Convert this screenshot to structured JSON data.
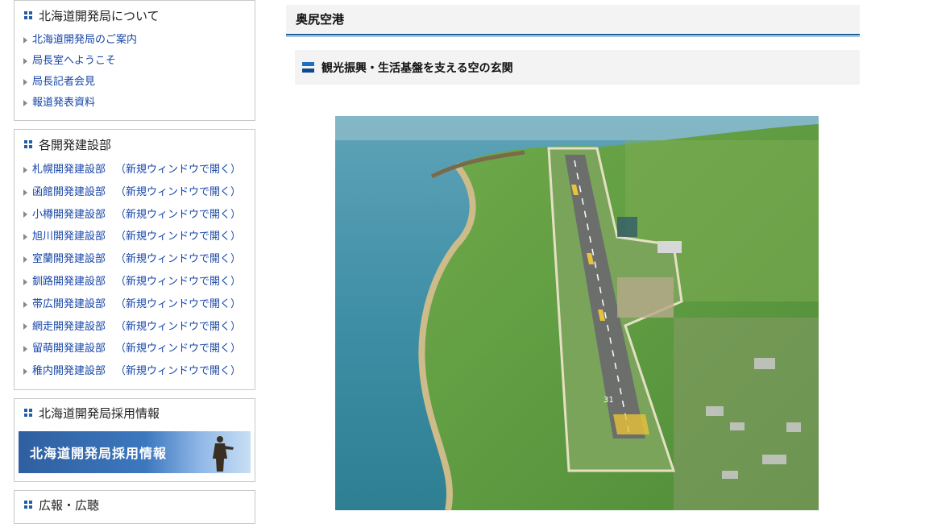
{
  "sidebar": {
    "about": {
      "title": "北海道開発局について",
      "items": [
        "北海道開発局のご案内",
        "局長室へようこそ",
        "局長記者会見",
        "報道発表資料"
      ]
    },
    "branches": {
      "title": "各開発建設部",
      "new_window_label": "（新規ウィンドウで開く）",
      "items": [
        "札幌開発建設部",
        "函館開発建設部",
        "小樽開発建設部",
        "旭川開発建設部",
        "室蘭開発建設部",
        "釧路開発建設部",
        "帯広開発建設部",
        "網走開発建設部",
        "留萌開発建設部",
        "稚内開発建設部"
      ]
    },
    "recruit": {
      "title": "北海道開発局採用情報",
      "banner_text": "北海道開発局採用情報"
    },
    "pr": {
      "title": "広報・広聴"
    }
  },
  "main": {
    "page_title": "奥尻空港",
    "subheading": "観光振興・生活基盤を支える空の玄関",
    "photo": {
      "runway_number": "31"
    }
  },
  "colors": {
    "link": "#1846a8",
    "accent": "#1a5c96",
    "sea": "#3f8fa6",
    "grass": "#5d9a3e"
  }
}
